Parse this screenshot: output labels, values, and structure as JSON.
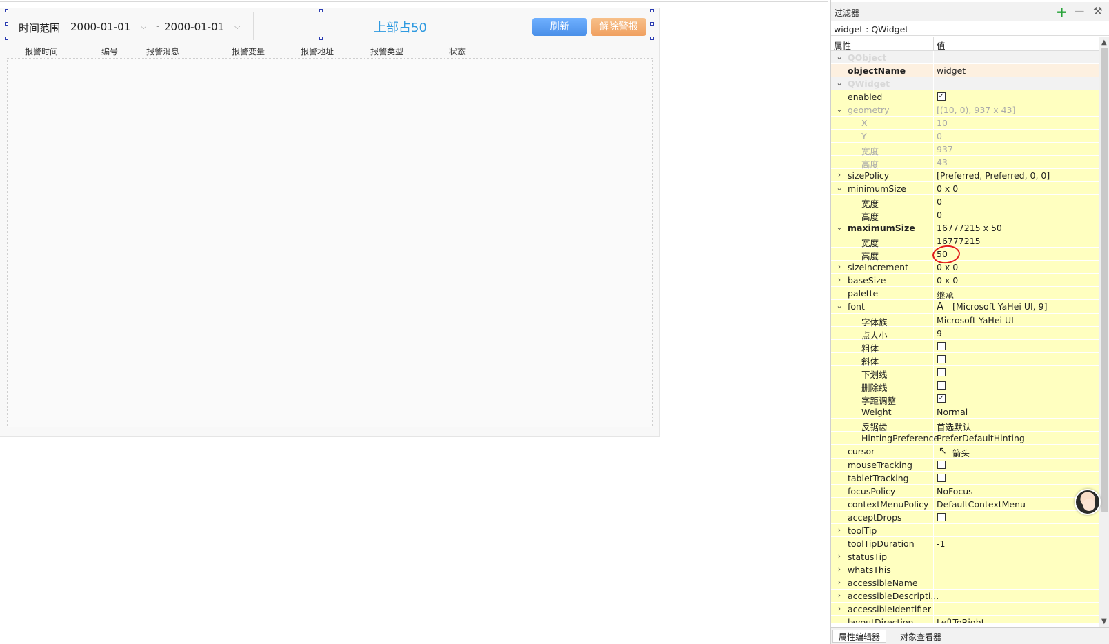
{
  "designer": {
    "header": {
      "time_range_label": "时间范围",
      "date_start": "2000-01-01",
      "date_separator": "-",
      "date_end": "2000-01-01",
      "title": "上部占50",
      "refresh_label": "刷新",
      "clear_alarm_label": "解除警报"
    },
    "table_columns": [
      "报警时间",
      "编号",
      "报警消息",
      "报警变量",
      "报警地址",
      "报警类型",
      "状态"
    ]
  },
  "property_editor": {
    "filter_label": "过滤器",
    "widget_line": "widget : QWidget",
    "col_property": "属性",
    "col_value": "值",
    "rows": [
      {
        "name": "QObject",
        "value": ""
      },
      {
        "name": "objectName",
        "value": "widget"
      },
      {
        "name": "QWidget",
        "value": ""
      },
      {
        "name": "enabled",
        "value": ""
      },
      {
        "name": "geometry",
        "value": "[(10, 0), 937 x 43]"
      },
      {
        "name": "X",
        "value": "10"
      },
      {
        "name": "Y",
        "value": "0"
      },
      {
        "name": "宽度",
        "value": "937"
      },
      {
        "name": "高度",
        "value": "43"
      },
      {
        "name": "sizePolicy",
        "value": "[Preferred, Preferred, 0, 0]"
      },
      {
        "name": "minimumSize",
        "value": "0 x 0"
      },
      {
        "name": "宽度",
        "value": "0"
      },
      {
        "name": "高度",
        "value": "0"
      },
      {
        "name": "maximumSize",
        "value": "16777215 x 50"
      },
      {
        "name": "宽度",
        "value": "16777215"
      },
      {
        "name": "高度",
        "value": "50"
      },
      {
        "name": "sizeIncrement",
        "value": "0 x 0"
      },
      {
        "name": "baseSize",
        "value": "0 x 0"
      },
      {
        "name": "palette",
        "value": "继承"
      },
      {
        "name": "font",
        "value": "[Microsoft YaHei UI, 9]"
      },
      {
        "name": "字体族",
        "value": "Microsoft YaHei UI"
      },
      {
        "name": "点大小",
        "value": "9"
      },
      {
        "name": "粗体",
        "value": ""
      },
      {
        "name": "斜体",
        "value": ""
      },
      {
        "name": "下划线",
        "value": ""
      },
      {
        "name": "删除线",
        "value": ""
      },
      {
        "name": "字距调整",
        "value": ""
      },
      {
        "name": "Weight",
        "value": "Normal"
      },
      {
        "name": "反锯齿",
        "value": "首选默认"
      },
      {
        "name": "HintingPreference",
        "value": "PreferDefaultHinting"
      },
      {
        "name": "cursor",
        "value": "箭头"
      },
      {
        "name": "mouseTracking",
        "value": ""
      },
      {
        "name": "tabletTracking",
        "value": ""
      },
      {
        "name": "focusPolicy",
        "value": "NoFocus"
      },
      {
        "name": "contextMenuPolicy",
        "value": "DefaultContextMenu"
      },
      {
        "name": "acceptDrops",
        "value": ""
      },
      {
        "name": "toolTip",
        "value": ""
      },
      {
        "name": "toolTipDuration",
        "value": "-1"
      },
      {
        "name": "statusTip",
        "value": ""
      },
      {
        "name": "whatsThis",
        "value": ""
      },
      {
        "name": "accessibleName",
        "value": ""
      },
      {
        "name": "accessibleDescripti...",
        "value": ""
      },
      {
        "name": "accessibleIdentifier",
        "value": ""
      },
      {
        "name": "layoutDirection",
        "value": "LeftToRight"
      }
    ],
    "tabs": [
      "属性编辑器",
      "对象查看器"
    ]
  },
  "colors": {
    "title_blue": "#2f9ae0",
    "refresh_blue": "#4a8fe8",
    "clear_orange": "#f0a060",
    "property_row_yellow": "#ffffc0",
    "annotation_red": "#e21b1b"
  }
}
